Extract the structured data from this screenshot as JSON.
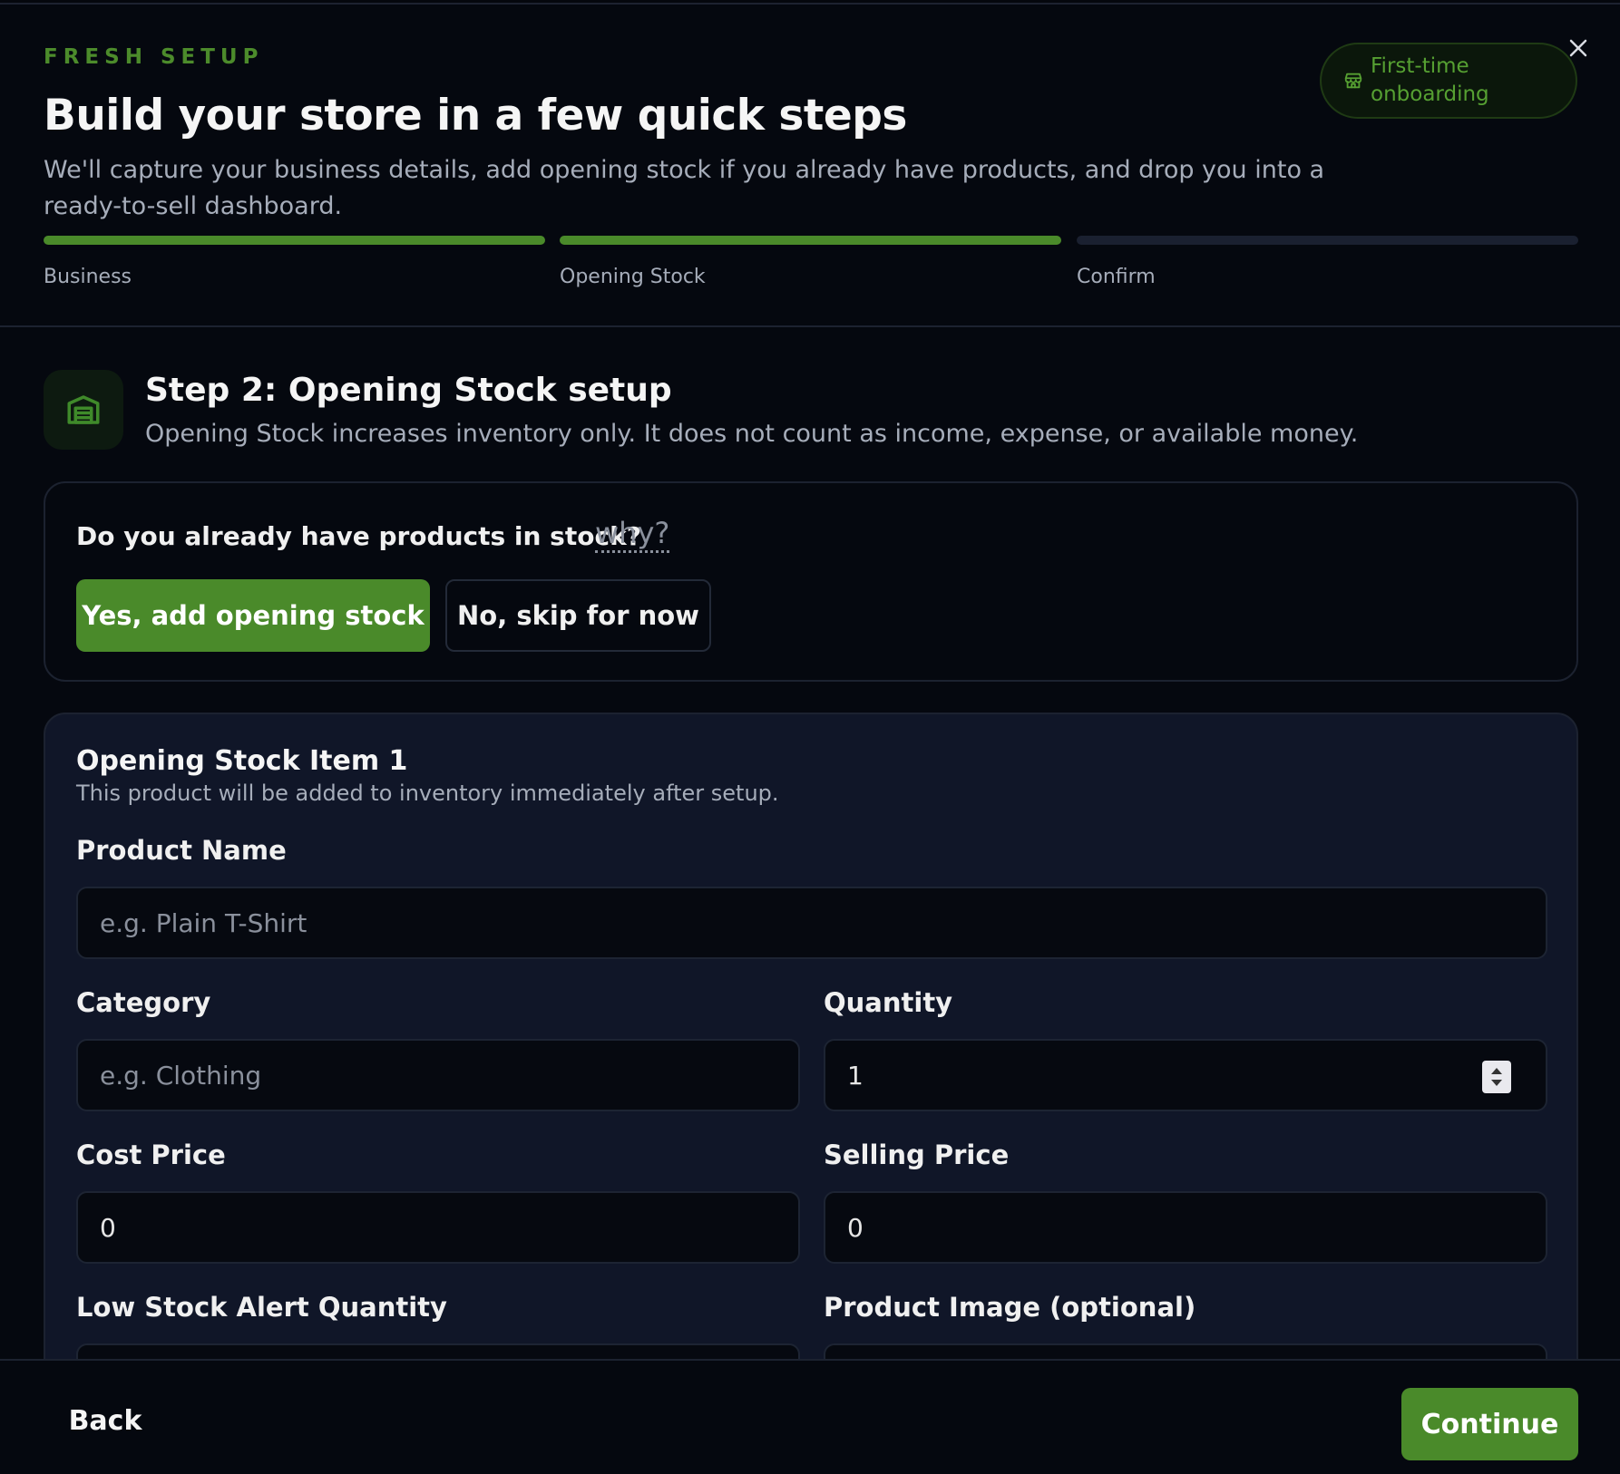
{
  "header": {
    "kicker": "FRESH SETUP",
    "title": "Build your store in a few quick steps",
    "subtitle": "We'll capture your business details, add opening stock if you already have products, and drop you into a ready-to-sell dashboard.",
    "badge": "First-time onboarding"
  },
  "progress": {
    "steps": [
      {
        "label": "Business",
        "complete": true
      },
      {
        "label": "Opening Stock",
        "complete": true
      },
      {
        "label": "Confirm",
        "complete": false
      }
    ]
  },
  "step": {
    "title": "Step 2: Opening Stock setup",
    "description": "Opening Stock increases inventory only. It does not count as income, expense, or available money."
  },
  "question": {
    "text": "Do you already have products in stock?",
    "why": "why?",
    "yes_label": "Yes, add opening stock",
    "no_label": "No, skip for now"
  },
  "item": {
    "title": "Opening Stock Item 1",
    "description": "This product will be added to inventory immediately after setup.",
    "fields": {
      "product_name": {
        "label": "Product Name",
        "placeholder": "e.g. Plain T-Shirt",
        "value": ""
      },
      "category": {
        "label": "Category",
        "placeholder": "e.g. Clothing",
        "value": ""
      },
      "quantity": {
        "label": "Quantity",
        "value": "1"
      },
      "cost_price": {
        "label": "Cost Price",
        "value": "0"
      },
      "selling_price": {
        "label": "Selling Price",
        "value": "0"
      },
      "low_stock": {
        "label": "Low Stock Alert Quantity"
      },
      "product_image": {
        "label": "Product Image (optional)"
      }
    }
  },
  "footer": {
    "back_label": "Back",
    "continue_label": "Continue"
  },
  "colors": {
    "accent": "#4a8a2a",
    "background": "#05080f",
    "card": "#101628"
  }
}
